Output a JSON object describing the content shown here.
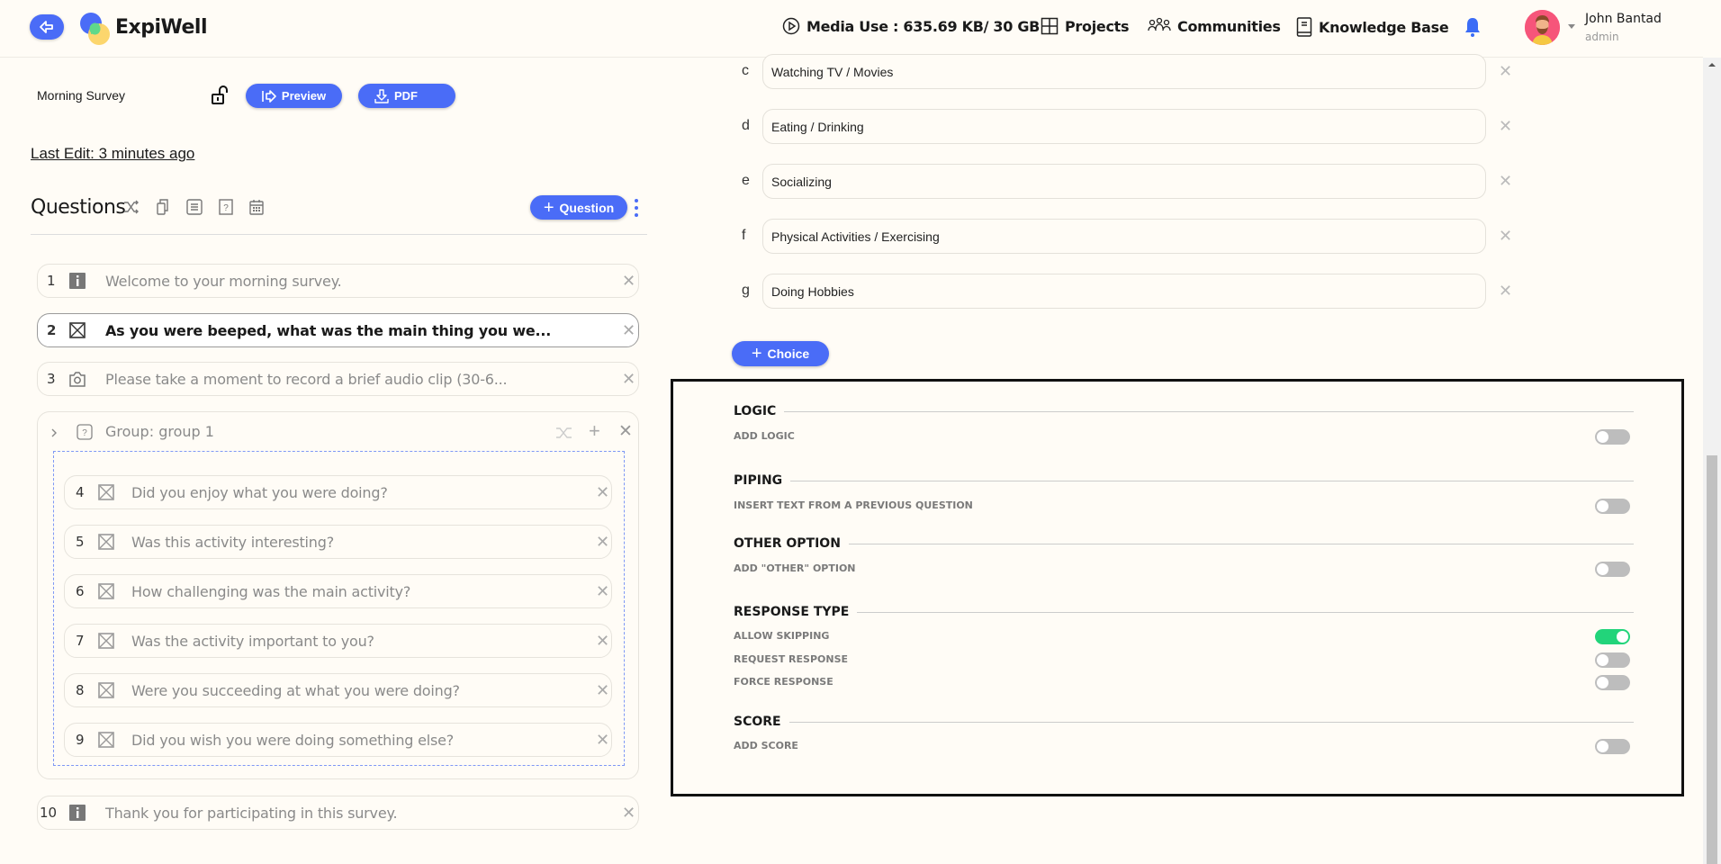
{
  "header": {
    "brand": "ExpiWell",
    "media_use": "Media Use : 635.69 KB/ 30 GB",
    "projects": "Projects",
    "communities": "Communities",
    "knowledge_base": "Knowledge Base",
    "user_name": "John Bantad",
    "user_role": "admin"
  },
  "survey": {
    "title": "Morning Survey",
    "preview_label": "Preview",
    "pdf_label": "PDF",
    "last_edit": "Last Edit: 3 minutes ago"
  },
  "questions": {
    "heading": "Questions",
    "add_label": "Question",
    "items": [
      {
        "num": "1",
        "type": "info",
        "text": "Welcome to your morning survey."
      },
      {
        "num": "2",
        "type": "multiple-choice",
        "text": "As you were beeped, what was the main thing you we...",
        "selected": true
      },
      {
        "num": "3",
        "type": "media",
        "text": "Please take a moment to record a brief audio clip (30-6..."
      }
    ],
    "group": {
      "label": "Group: group 1",
      "items": [
        {
          "num": "4",
          "text": "Did you enjoy what you were doing?"
        },
        {
          "num": "5",
          "text": "Was this activity interesting?"
        },
        {
          "num": "6",
          "text": "How challenging was the main activity?"
        },
        {
          "num": "7",
          "text": "Was the activity important to you?"
        },
        {
          "num": "8",
          "text": "Were you succeeding at what you were doing?"
        },
        {
          "num": "9",
          "text": "Did you wish you were doing something else?"
        }
      ]
    },
    "last": {
      "num": "10",
      "type": "info",
      "text": "Thank you for participating in this survey."
    }
  },
  "choices": {
    "items": [
      {
        "letter": "c",
        "value": "Watching TV / Movies"
      },
      {
        "letter": "d",
        "value": "Eating / Drinking"
      },
      {
        "letter": "e",
        "value": "Socializing"
      },
      {
        "letter": "f",
        "value": "Physical Activities / Exercising"
      },
      {
        "letter": "g",
        "value": "Doing Hobbies"
      }
    ],
    "add_label": "Choice"
  },
  "settings": {
    "sections": [
      {
        "heading": "LOGIC",
        "options": [
          {
            "label": "ADD LOGIC",
            "on": false
          }
        ]
      },
      {
        "heading": "PIPING",
        "options": [
          {
            "label": "INSERT TEXT FROM A PREVIOUS QUESTION",
            "on": false
          }
        ]
      },
      {
        "heading": "OTHER OPTION",
        "options": [
          {
            "label": "ADD \"OTHER\" OPTION",
            "on": false
          }
        ]
      },
      {
        "heading": "RESPONSE TYPE",
        "options": [
          {
            "label": "ALLOW SKIPPING",
            "on": true
          },
          {
            "label": "REQUEST RESPONSE",
            "on": false
          },
          {
            "label": "FORCE RESPONSE",
            "on": false
          }
        ]
      },
      {
        "heading": "SCORE",
        "options": [
          {
            "label": "ADD SCORE",
            "on": false
          }
        ]
      }
    ]
  },
  "colors": {
    "accent": "#4a6cf7",
    "toggle_on": "#22d47a",
    "background": "#fffcf6"
  }
}
